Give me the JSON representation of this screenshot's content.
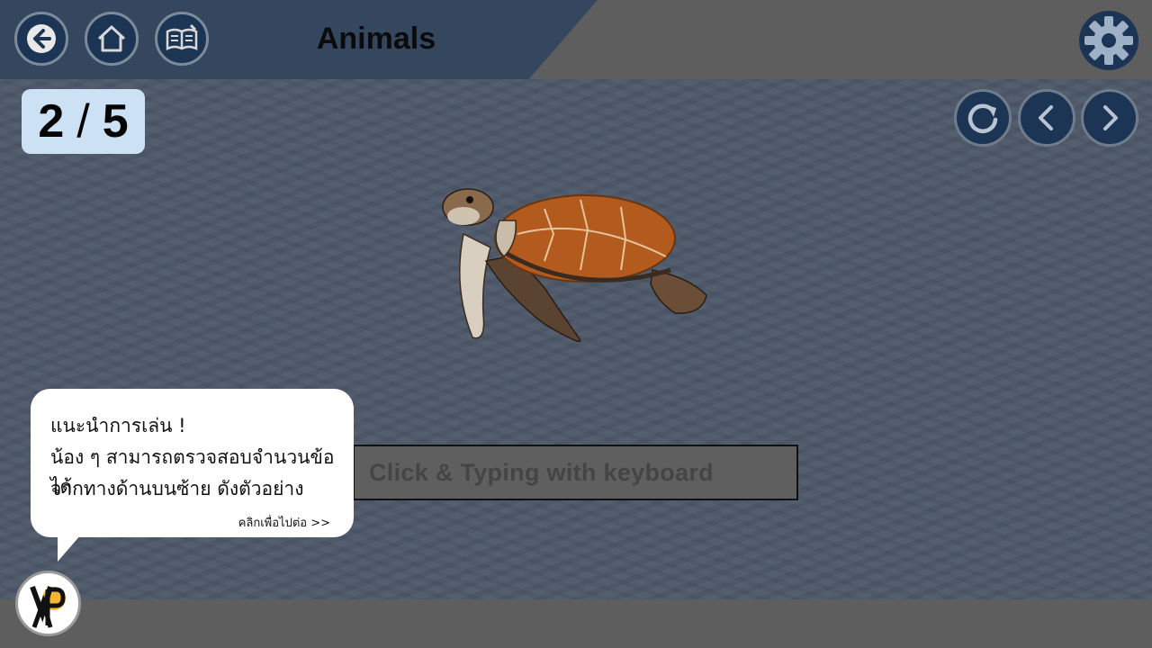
{
  "header": {
    "title": "Animals",
    "back_icon": "back-arrow-icon",
    "home_icon": "home-icon",
    "book_icon": "book-edit-icon",
    "settings_icon": "gear-icon"
  },
  "progress": {
    "current": "2",
    "separator": "/",
    "total": "5"
  },
  "controls": {
    "replay_icon": "replay-icon",
    "prev_icon": "chevron-left-icon",
    "next_icon": "chevron-right-icon"
  },
  "content": {
    "image": "sea-turtle"
  },
  "answer": {
    "placeholder": "Click & Typing with keyboard"
  },
  "hint": {
    "line1": "แนะนำการเล่น !",
    "line2": "น้อง ๆ สามารถตรวจสอบจำนวนข้อได้",
    "line3": "จากทางด้านบนซ้าย ดังตัวอย่าง",
    "next": "คลิกเพื่อไปต่อ >>"
  },
  "colors": {
    "header_blue": "#34475f",
    "button_navy": "#1d3555",
    "counter_bg": "#cde1f5",
    "stage_bg": "#4d5868"
  }
}
